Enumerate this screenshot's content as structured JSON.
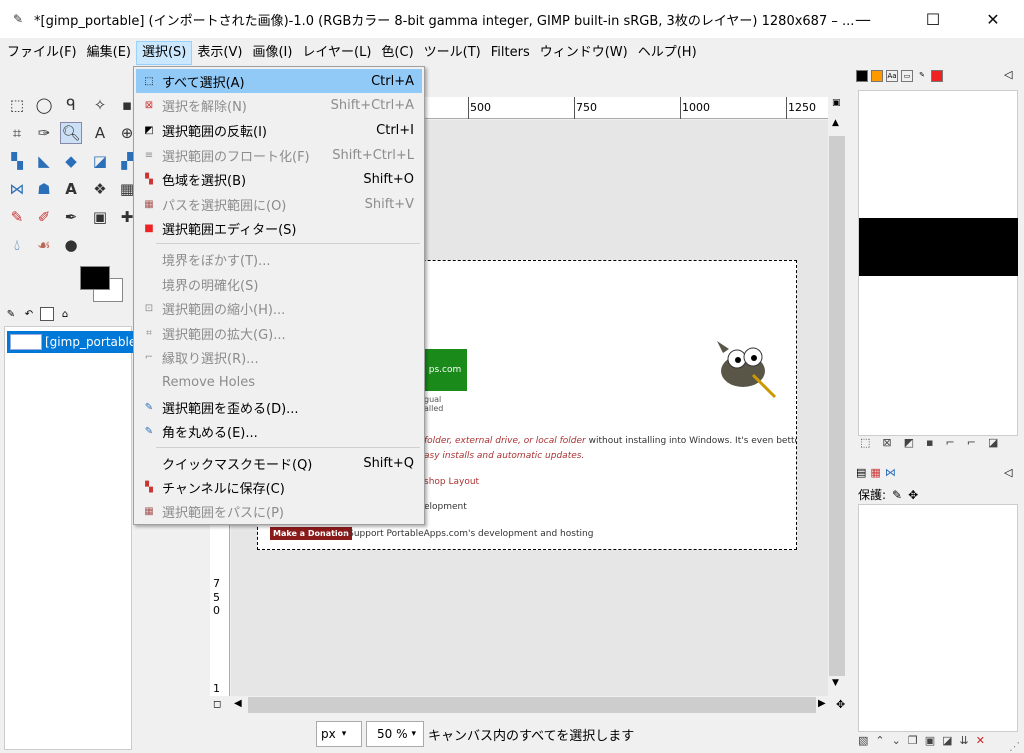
{
  "window": {
    "title": "*[gimp_portable] (インポートされた画像)-1.0 (RGBカラー 8-bit gamma integer, GIMP built-in sRGB, 3枚のレイヤー) 1280x687 – ...",
    "minimize": "—",
    "maximize": "☐",
    "close": "✕"
  },
  "menubar": [
    "ファイル(F)",
    "編集(E)",
    "選択(S)",
    "表示(V)",
    "画像(I)",
    "レイヤー(L)",
    "色(C)",
    "ツール(T)",
    "Filters",
    "ウィンドウ(W)",
    "ヘルプ(H)"
  ],
  "select_menu": {
    "items": [
      {
        "label": "すべて選択(A)",
        "shortcut": "Ctrl+A",
        "icon": "select-all-icon"
      },
      {
        "label": "選択を解除(N)",
        "shortcut": "Shift+Ctrl+A",
        "icon": "select-none-icon"
      },
      {
        "label": "選択範囲の反転(I)",
        "shortcut": "Ctrl+I",
        "icon": "invert-selection-icon"
      },
      {
        "label": "選択範囲のフロート化(F)",
        "shortcut": "Shift+Ctrl+L",
        "icon": "float-selection-icon"
      },
      {
        "label": "色域を選択(B)",
        "shortcut": "Shift+O",
        "icon": "select-by-color-icon"
      },
      {
        "label": "パスを選択範囲に(O)",
        "shortcut": "Shift+V",
        "icon": "path-to-selection-icon"
      },
      {
        "label": "選択範囲エディター(S)",
        "shortcut": "",
        "icon": "selection-editor-icon"
      },
      {
        "label": "境界をぼかす(T)...",
        "shortcut": "",
        "icon": ""
      },
      {
        "label": "境界の明確化(S)",
        "shortcut": "",
        "icon": ""
      },
      {
        "label": "選択範囲の縮小(H)...",
        "shortcut": "",
        "icon": "shrink-selection-icon"
      },
      {
        "label": "選択範囲の拡大(G)...",
        "shortcut": "",
        "icon": "grow-selection-icon"
      },
      {
        "label": "縁取り選択(R)...",
        "shortcut": "",
        "icon": "border-selection-icon"
      },
      {
        "label": "Remove Holes",
        "shortcut": "",
        "icon": ""
      },
      {
        "label": "選択範囲を歪める(D)...",
        "shortcut": "",
        "icon": "distort-icon"
      },
      {
        "label": "角を丸める(E)...",
        "shortcut": "",
        "icon": "rounded-rect-icon"
      },
      {
        "label": "クイックマスクモード(Q)",
        "shortcut": "Shift+Q",
        "icon": ""
      },
      {
        "label": "チャンネルに保存(C)",
        "shortcut": "",
        "icon": "save-to-channel-icon"
      },
      {
        "label": "選択範囲をパスに(P)",
        "shortcut": "",
        "icon": "selection-to-path-icon"
      }
    ]
  },
  "ruler": {
    "top_ticks": [
      "500",
      "750",
      "1000",
      "1250"
    ],
    "left_digits": [
      "7",
      "5",
      "0",
      "1"
    ]
  },
  "images_panel": {
    "item": "[gimp_portable]"
  },
  "canvas_content": {
    "green_text": "ps.com",
    "small1": "gual",
    "small2": "alled",
    "italic_line1_prefix": "folder, external drive, or local folder",
    "italic_line1_suffix": " without installing into Windows. It's even better with",
    "italic_line2": "asy installs and automatic updates.",
    "link1": "shop Layout",
    "line2": "elopment",
    "donate_button": "Make a Donation",
    "donate_text": "- Support PortableApps.com's development and hosting"
  },
  "statusbar": {
    "unit": "px",
    "zoom": "50 %",
    "message": "キャンバス内のすべてを選択します"
  },
  "right_dock": {
    "lock_label": "保護:"
  }
}
